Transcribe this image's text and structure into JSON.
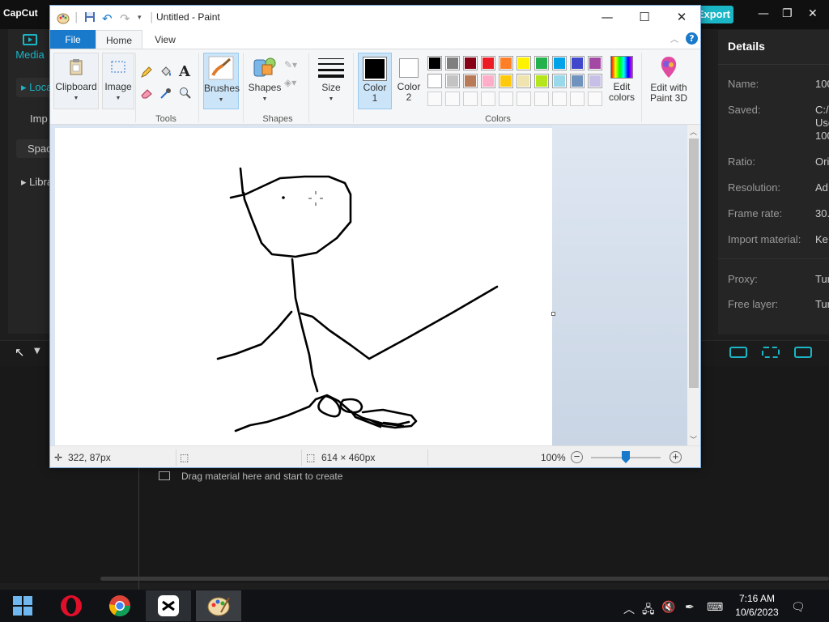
{
  "capcut": {
    "logo": "CapCut",
    "export_label": "Export",
    "media_label": "Media",
    "sidebar": [
      "Loca",
      "Imp",
      "Spac",
      "Libra"
    ],
    "details": {
      "title": "Details",
      "rows": [
        {
          "label": "Name:",
          "value": "100"
        },
        {
          "label": "Saved:",
          "value": "C:/\nUse\n100"
        },
        {
          "label": "Ratio:",
          "value": "Ori"
        },
        {
          "label": "Resolution:",
          "value": "Ad"
        },
        {
          "label": "Frame rate:",
          "value": "30."
        },
        {
          "label": "Import material:",
          "value": "Ke"
        },
        {
          "label": "Proxy:",
          "value": "Tur"
        },
        {
          "label": "Free layer:",
          "value": "Tur"
        }
      ]
    },
    "drag_hint": "Drag material here and start to create",
    "accent": "#1ab6c6"
  },
  "paint": {
    "title": "Untitled - Paint",
    "tabs": {
      "file": "File",
      "home": "Home",
      "view": "View"
    },
    "help": "?",
    "ribbon": {
      "clipboard": "Clipboard",
      "image": "Image",
      "tools_group": "Tools",
      "brushes": "Brushes",
      "shapes": "Shapes",
      "shapes_group": "Shapes",
      "size": "Size",
      "color1": "Color\n1",
      "color2": "Color\n2",
      "colors_group": "Colors",
      "edit_colors": "Edit\ncolors",
      "edit_paint3d": "Edit with\nPaint 3D"
    },
    "palette_row1": [
      "#000000",
      "#7f7f7f",
      "#880015",
      "#ed1c24",
      "#ff7f27",
      "#fff200",
      "#22b14c",
      "#00a2e8",
      "#3f48cc",
      "#a349a4"
    ],
    "palette_row2": [
      "#ffffff",
      "#c3c3c3",
      "#b97a57",
      "#ffaec9",
      "#ffc90e",
      "#efe4b0",
      "#b5e61d",
      "#99d9ea",
      "#7092be",
      "#c8bfe7"
    ],
    "color1": "#000000",
    "color2": "#ffffff",
    "status": {
      "cursor_pos": "322, 87px",
      "canvas_size": "614 × 460px",
      "zoom": "100%",
      "zoom_level_percent": 100
    }
  },
  "taskbar": {
    "time": "7:16 AM",
    "date": "10/6/2023"
  }
}
